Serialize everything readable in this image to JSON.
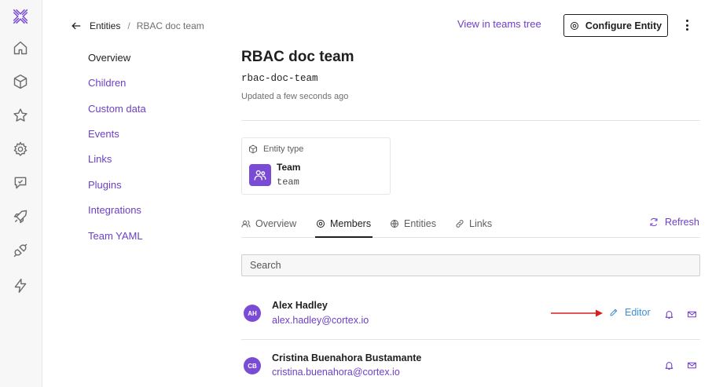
{
  "breadcrumb": {
    "parent": "Entities",
    "separator": "/",
    "current": "RBAC doc team"
  },
  "header": {
    "view_tree_link": "View in teams tree",
    "configure_button": "Configure Entity",
    "title": "RBAC doc team",
    "tag": "rbac-doc-team",
    "updated": "Updated a few seconds ago"
  },
  "sidenav": {
    "items": [
      {
        "label": "Overview"
      },
      {
        "label": "Children"
      },
      {
        "label": "Custom data"
      },
      {
        "label": "Events"
      },
      {
        "label": "Links"
      },
      {
        "label": "Plugins"
      },
      {
        "label": "Integrations"
      },
      {
        "label": "Team YAML"
      }
    ]
  },
  "entity_type": {
    "label": "Entity type",
    "name": "Team",
    "tag": "team"
  },
  "tabs": [
    {
      "label": "Overview"
    },
    {
      "label": "Members"
    },
    {
      "label": "Entities"
    },
    {
      "label": "Links"
    }
  ],
  "refresh_label": "Refresh",
  "search": {
    "placeholder": "Search"
  },
  "members": [
    {
      "initials": "AH",
      "name": "Alex Hadley",
      "email": "alex.hadley@cortex.io",
      "role": "Editor"
    },
    {
      "initials": "CB",
      "name": "Cristina Buenahora Bustamante",
      "email": "cristina.buenahora@cortex.io"
    }
  ],
  "colors": {
    "accent": "#6d3fc7",
    "avatar": "#7a4bd4",
    "editor": "#3d8fd6",
    "annotation_arrow": "#d42020"
  }
}
